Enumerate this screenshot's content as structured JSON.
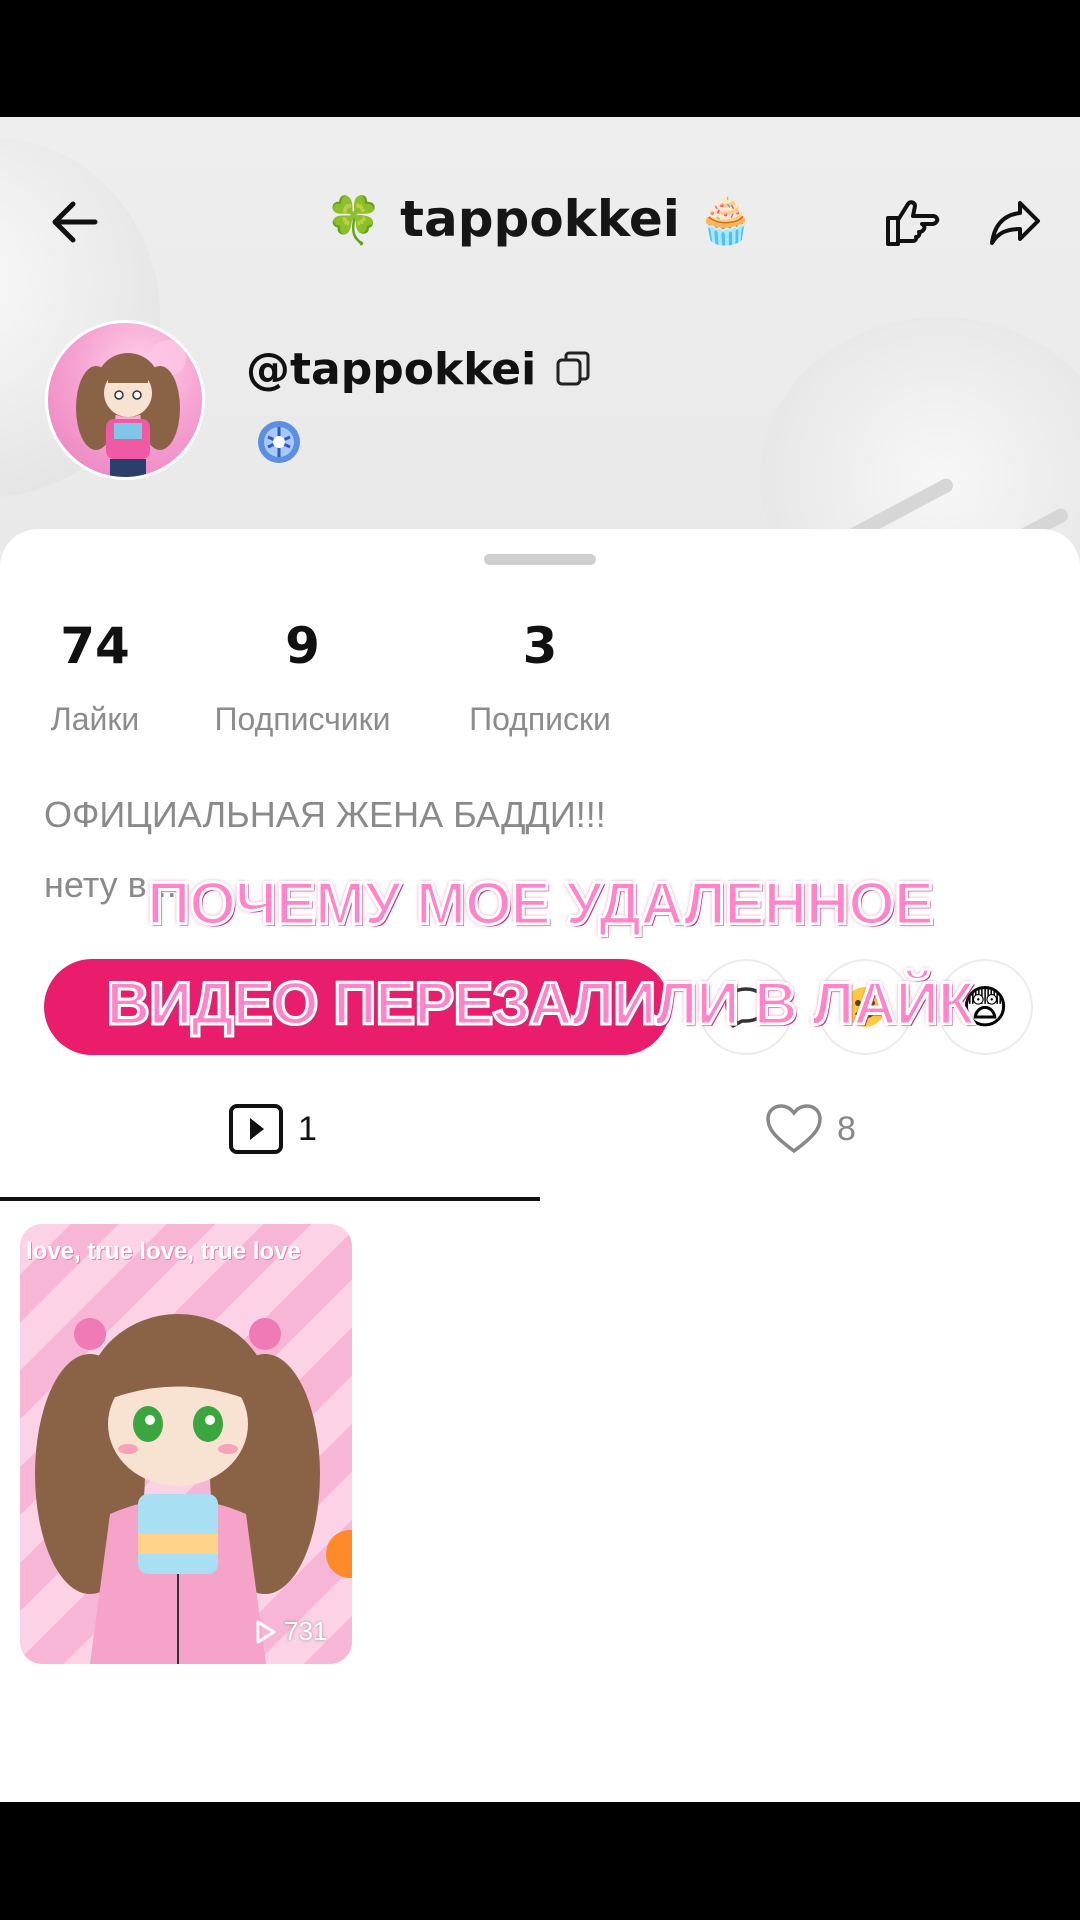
{
  "header": {
    "title": "tappokkei",
    "title_prefix_emoji": "🍀",
    "title_suffix_emoji": "🧁",
    "handle": "@tappokkei"
  },
  "stats": [
    {
      "value": "74",
      "label": "Лайки"
    },
    {
      "value": "9",
      "label": "Подписчики"
    },
    {
      "value": "3",
      "label": "Подписки"
    }
  ],
  "bio": {
    "line1": "ОФИЦИАЛЬНАЯ ЖЕНА БАДДИ!!!",
    "line2": "нету в ..."
  },
  "actions": {
    "emoji_3": "😨"
  },
  "overlay": {
    "line1": "ПОЧЕМУ МОЕ УДАЛЕННОЕ",
    "line2": "ВИДЕО ПЕРЕЗАЛИЛИ В ЛАЙК"
  },
  "tabs": {
    "videos_count": "1",
    "liked_count": "8"
  },
  "videos": [
    {
      "thumb_text": "love, true love, true love",
      "views": "731"
    }
  ],
  "colors": {
    "accent": "#ea1d6c",
    "overlay_text": "#ff84c9"
  }
}
